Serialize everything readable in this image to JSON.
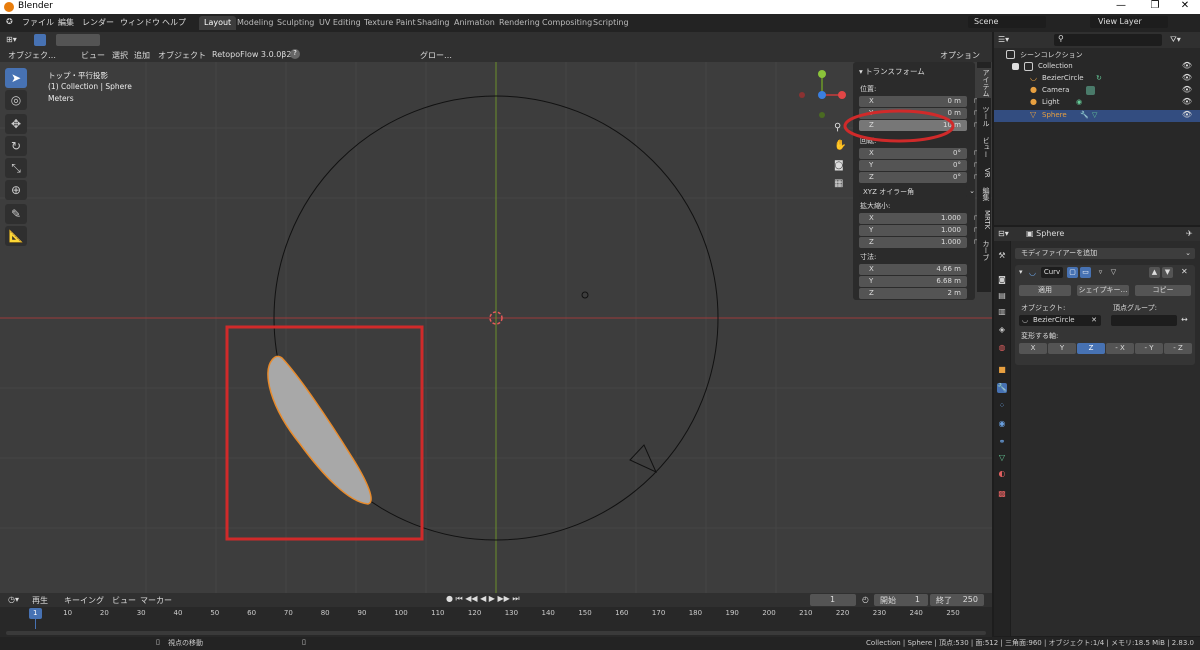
{
  "window": {
    "title": "Blender",
    "controls": [
      "—",
      "❐",
      "✕"
    ]
  },
  "menus": [
    "ファイル",
    "編集",
    "レンダー",
    "ウィンドウ",
    "ヘルプ"
  ],
  "workspaces": [
    {
      "label": "Layout",
      "active": true
    },
    {
      "label": "Modeling"
    },
    {
      "label": "Sculpting"
    },
    {
      "label": "UV Editing"
    },
    {
      "label": "Texture Paint"
    },
    {
      "label": "Shading"
    },
    {
      "label": "Animation"
    },
    {
      "label": "Rendering"
    },
    {
      "label": "Compositing"
    },
    {
      "label": "Scripting"
    }
  ],
  "scene": {
    "name": "Scene",
    "view_layer": "View Layer"
  },
  "viewport_header": {
    "mode": "オブジェク…",
    "view": "ビュー",
    "select": "選択",
    "add": "追加",
    "object": "オブジェクト",
    "addon": "RetopoFlow 3.0.0β2",
    "orientation": "グロー…",
    "options": "オプション"
  },
  "viewport_info": {
    "line1": "トップ・平行投影",
    "line2": "(1) Collection | Sphere",
    "line3": "Meters"
  },
  "transform_panel": {
    "title": "トランスフォーム",
    "location_label": "位置:",
    "location": [
      {
        "axis": "X",
        "value": "0 m"
      },
      {
        "axis": "Y",
        "value": "0 m"
      },
      {
        "axis": "Z",
        "value": "10 m"
      }
    ],
    "rotation_label": "回転:",
    "rotation": [
      {
        "axis": "X",
        "value": "0°"
      },
      {
        "axis": "Y",
        "value": "0°"
      },
      {
        "axis": "Z",
        "value": "0°"
      }
    ],
    "rotation_mode": "XYZ オイラー角",
    "scale_label": "拡大縮小:",
    "scale": [
      {
        "axis": "X",
        "value": "1.000"
      },
      {
        "axis": "Y",
        "value": "1.000"
      },
      {
        "axis": "Z",
        "value": "1.000"
      }
    ],
    "dimensions_label": "寸法:",
    "dimensions": [
      {
        "axis": "X",
        "value": "4.66 m"
      },
      {
        "axis": "Y",
        "value": "6.68 m"
      },
      {
        "axis": "Z",
        "value": "2 m"
      }
    ]
  },
  "side_tabs": [
    "アイテム",
    "ツール",
    "ビュー",
    "VR",
    "編集",
    "MRTK",
    "カーブ"
  ],
  "outliner": {
    "root": "シーンコレクション",
    "collection": "Collection",
    "items": [
      "BezierCircle",
      "Camera",
      "Light",
      "Sphere"
    ],
    "selected": "Sphere"
  },
  "properties": {
    "object_name": "Sphere",
    "add_modifier": "モディファイアーを追加",
    "modifier_name": "Curv",
    "apply": "適用",
    "shape_key": "シェイプキー…",
    "copy": "コピー",
    "object_label": "オブジェクト:",
    "object_value": "BezierCircle",
    "vertex_group_label": "頂点グループ:",
    "deform_axis_label": "変形する軸:",
    "axes": [
      {
        "label": "X"
      },
      {
        "label": "Y"
      },
      {
        "label": "Z",
        "active": true
      },
      {
        "label": "- X"
      },
      {
        "label": "- Y"
      },
      {
        "label": "- Z"
      }
    ]
  },
  "timeline": {
    "playback": "再生",
    "keying": "キーイング",
    "view": "ビュー",
    "marker": "マーカー",
    "current": "1",
    "start_label": "開始",
    "start": "1",
    "end_label": "終了",
    "end": "250",
    "frames": [
      "1",
      "10",
      "20",
      "30",
      "40",
      "50",
      "60",
      "70",
      "80",
      "90",
      "100",
      "110",
      "120",
      "130",
      "140",
      "150",
      "160",
      "170",
      "180",
      "190",
      "200",
      "210",
      "220",
      "230",
      "240",
      "250"
    ]
  },
  "status": {
    "hint": "視点の移動",
    "info": "Collection | Sphere | 頂点:530 | 面:512 | 三角面:960 | オブジェクト:1/4 | メモリ:18.5 MiB | 2.83.0"
  },
  "colors": {
    "accent": "#4772b3",
    "selection": "#e88b2c",
    "annotation": "#d02a2a",
    "x_axis": "#c83c3c",
    "y_axis": "#6c9a28"
  }
}
